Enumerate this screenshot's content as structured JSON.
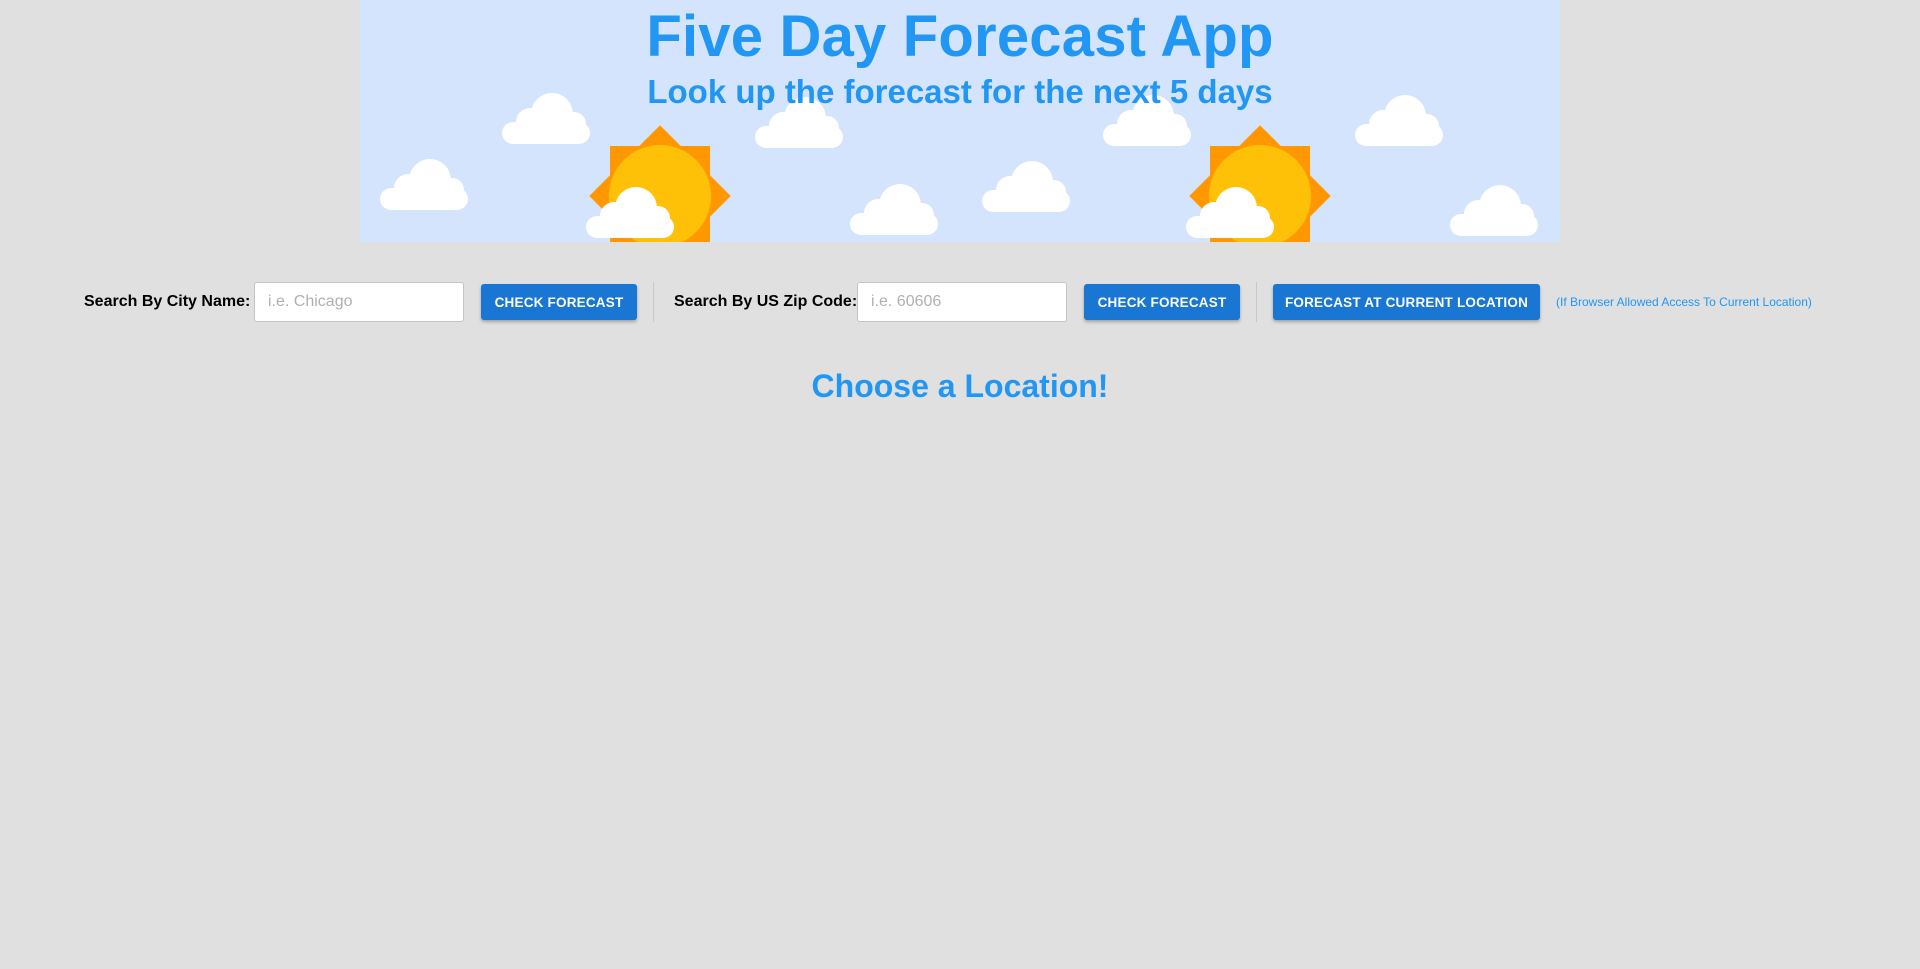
{
  "header": {
    "title": "Five Day Forecast App",
    "subtitle": "Look up the forecast for the next 5 days"
  },
  "city_search": {
    "label": "Search By City Name:",
    "placeholder": "i.e. Chicago",
    "value": "",
    "button_label": "CHECK FORECAST"
  },
  "zip_search": {
    "label": "Search By US Zip Code:",
    "placeholder": "i.e. 60606",
    "value": "",
    "button_label": "CHECK FORECAST"
  },
  "location_search": {
    "button_label": "FORECAST AT CURRENT LOCATION",
    "note": "(If Browser Allowed Access To Current Location)"
  },
  "main": {
    "prompt": "Choose a Location!"
  },
  "colors": {
    "page_background": "#e0e0e0",
    "banner_background": "#d3e4fc",
    "accent_text": "#2196f3",
    "button": "#1976d2",
    "sun": "#ffc107",
    "sun_rays": "#ff9800",
    "cloud": "#ffffff"
  },
  "icons": [
    "sun-icon",
    "cloud-icon"
  ]
}
